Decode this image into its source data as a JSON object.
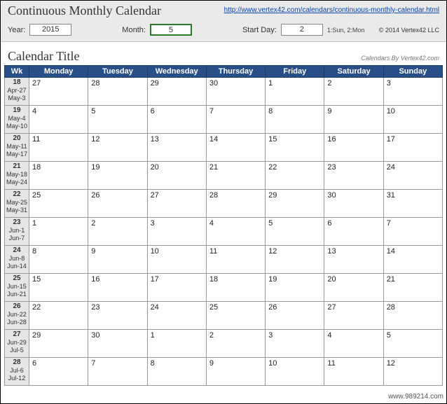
{
  "header": {
    "title": "Continuous Monthly Calendar",
    "link": "http://www.vertex42.com/calendars/continuous-monthly-calendar.html",
    "year_label": "Year:",
    "year_value": "2015",
    "month_label": "Month:",
    "month_value": "5",
    "startday_label": "Start Day:",
    "startday_value": "2",
    "startday_hint": "1:Sun, 2:Mon",
    "copyright": "© 2014 Vertex42 LLC"
  },
  "subheader": {
    "title": "Calendar Title",
    "credits": "Calendars By Vertex42.com"
  },
  "calendar": {
    "columns": [
      "Wk",
      "Monday",
      "Tuesday",
      "Wednesday",
      "Thursday",
      "Friday",
      "Saturday",
      "Sunday"
    ],
    "weeks": [
      {
        "wk": "18",
        "range_a": "Apr-27",
        "range_b": "May-3",
        "days": [
          "27",
          "28",
          "29",
          "30",
          "1",
          "2",
          "3"
        ]
      },
      {
        "wk": "19",
        "range_a": "May-4",
        "range_b": "May-10",
        "days": [
          "4",
          "5",
          "6",
          "7",
          "8",
          "9",
          "10"
        ]
      },
      {
        "wk": "20",
        "range_a": "May-11",
        "range_b": "May-17",
        "days": [
          "11",
          "12",
          "13",
          "14",
          "15",
          "16",
          "17"
        ]
      },
      {
        "wk": "21",
        "range_a": "May-18",
        "range_b": "May-24",
        "days": [
          "18",
          "19",
          "20",
          "21",
          "22",
          "23",
          "24"
        ]
      },
      {
        "wk": "22",
        "range_a": "May-25",
        "range_b": "May-31",
        "days": [
          "25",
          "26",
          "27",
          "28",
          "29",
          "30",
          "31"
        ]
      },
      {
        "wk": "23",
        "range_a": "Jun-1",
        "range_b": "Jun-7",
        "days": [
          "1",
          "2",
          "3",
          "4",
          "5",
          "6",
          "7"
        ]
      },
      {
        "wk": "24",
        "range_a": "Jun-8",
        "range_b": "Jun-14",
        "days": [
          "8",
          "9",
          "10",
          "11",
          "12",
          "13",
          "14"
        ]
      },
      {
        "wk": "25",
        "range_a": "Jun-15",
        "range_b": "Jun-21",
        "days": [
          "15",
          "16",
          "17",
          "18",
          "19",
          "20",
          "21"
        ]
      },
      {
        "wk": "26",
        "range_a": "Jun-22",
        "range_b": "Jun-28",
        "days": [
          "22",
          "23",
          "24",
          "25",
          "26",
          "27",
          "28"
        ]
      },
      {
        "wk": "27",
        "range_a": "Jun-29",
        "range_b": "Jul-5",
        "days": [
          "29",
          "30",
          "1",
          "2",
          "3",
          "4",
          "5"
        ]
      },
      {
        "wk": "28",
        "range_a": "Jul-6",
        "range_b": "Jul-12",
        "days": [
          "6",
          "7",
          "8",
          "9",
          "10",
          "11",
          "12"
        ]
      }
    ]
  },
  "watermark": "www.989214.com"
}
